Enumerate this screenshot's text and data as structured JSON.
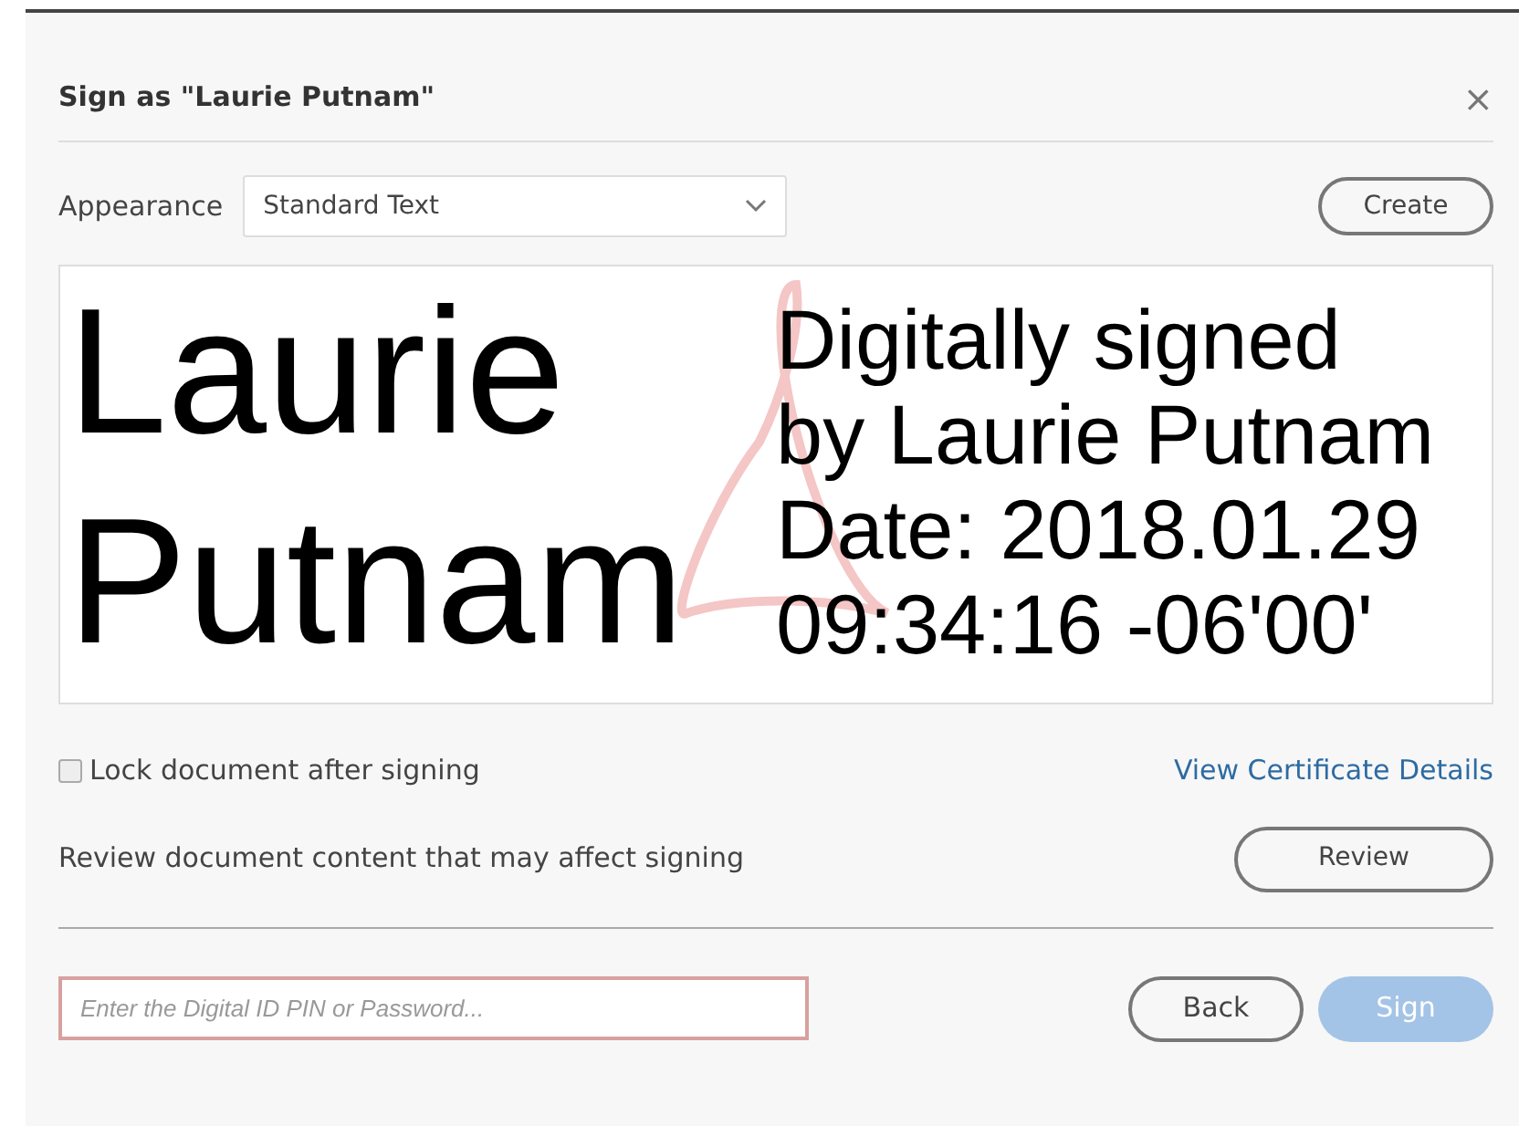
{
  "dialog": {
    "title": "Sign as \"Laurie Putnam\"",
    "close": "×"
  },
  "appearance": {
    "label": "Appearance",
    "value": "Standard Text",
    "create_button": "Create"
  },
  "preview": {
    "name_lines": [
      "Laurie",
      "Putnam"
    ],
    "detail_lines": [
      "Digitally signed",
      "by Laurie Putnam",
      "Date: 2018.01.29",
      "09:34:16 -06'00'"
    ]
  },
  "lock": {
    "label": "Lock document after signing",
    "checked": false
  },
  "certificate_link": "View Certificate Details",
  "review": {
    "text": "Review document content that may affect signing",
    "button": "Review"
  },
  "pin_field": {
    "placeholder": "Enter the Digital ID PIN or Password..."
  },
  "buttons": [
    {
      "label": "Back",
      "kind": "outline",
      "disabled": false
    },
    {
      "label": "Sign",
      "kind": "primary",
      "disabled": true
    }
  ]
}
